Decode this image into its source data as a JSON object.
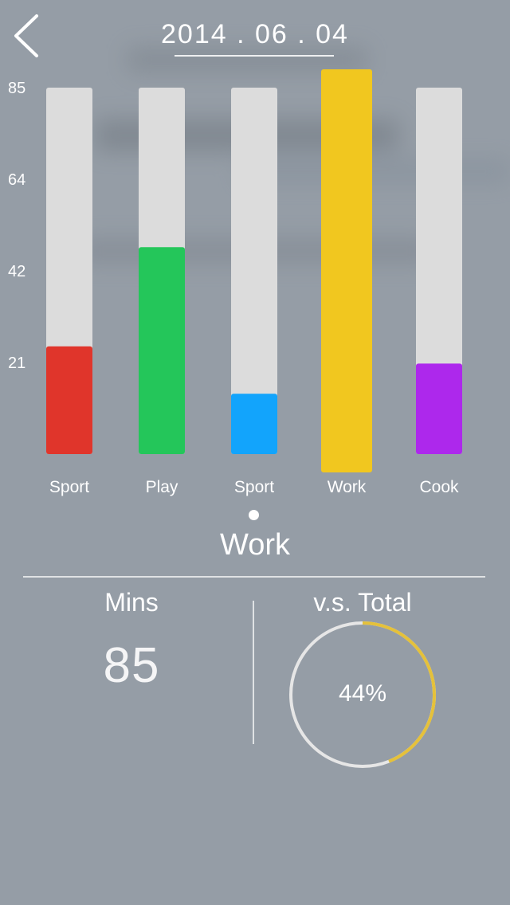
{
  "header": {
    "date": "2014 . 06 . 04"
  },
  "icons": {
    "back": "chevron-left-icon"
  },
  "chart_data": {
    "type": "bar",
    "y_ticks": [
      "85",
      "64",
      "42",
      "21"
    ],
    "categories": [
      "Sport",
      "Play",
      "Sport",
      "Work",
      "Cook"
    ],
    "values": [
      25,
      48,
      14,
      85,
      21
    ],
    "ylim": [
      0,
      85
    ],
    "colors": [
      "#e0352b",
      "#24c65a",
      "#12a4fc",
      "#f1c71f",
      "#ad28ec"
    ],
    "track_color": "#dcdcdc",
    "selected_index": 3,
    "grid": false
  },
  "selection": {
    "name": "Work"
  },
  "stats": {
    "mins_label": "Mins",
    "mins_value": "85",
    "total_label": "v.s. Total",
    "total_percent": "44%",
    "total_fraction": 0.44,
    "ring_color": "#e5c13a",
    "ring_track_color": "#e6e6e6"
  }
}
